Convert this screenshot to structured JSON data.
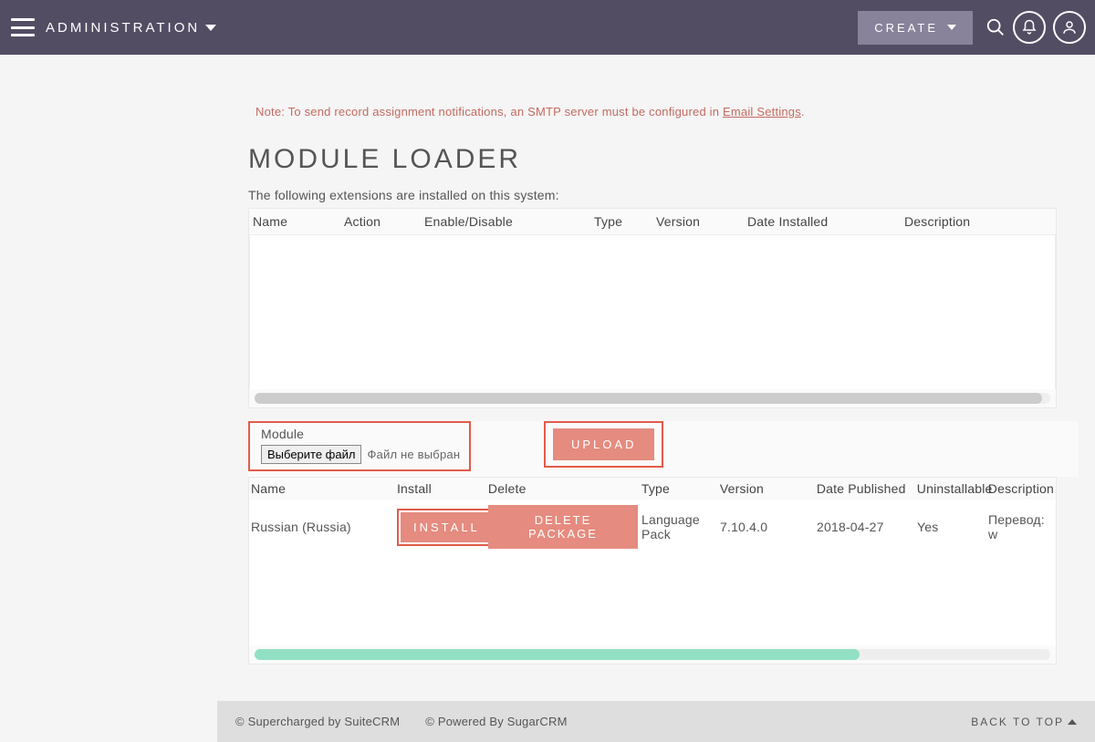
{
  "header": {
    "crumb": "ADMINISTRATION",
    "create": "CREATE"
  },
  "note": {
    "prefix": "Note: To send record assignment notifications, an SMTP server must be configured in ",
    "link": "Email Settings",
    "suffix": "."
  },
  "title": "MODULE LOADER",
  "installed": {
    "desc": "The following extensions are installed on this system:",
    "cols": [
      "Name",
      "Action",
      "Enable/Disable",
      "Type",
      "Version",
      "Date Installed",
      "Description"
    ]
  },
  "upload": {
    "module_label": "Module",
    "choose_file": "Выберите файл",
    "no_file": "Файл не выбран",
    "upload_btn": "UPLOAD"
  },
  "packages": {
    "cols": [
      "Name",
      "Install",
      "Delete",
      "Type",
      "Version",
      "Date Published",
      "Uninstallable",
      "Description"
    ],
    "rows": [
      {
        "name": "Russian (Russia)",
        "install_btn": "INSTALL",
        "delete_btn": "DELETE PACKAGE",
        "type": "Language Pack",
        "version": "7.10.4.0",
        "date": "2018-04-27",
        "uninstallable": "Yes",
        "description": "Перевод: w"
      }
    ]
  },
  "footer": {
    "s1": "© Supercharged by SuiteCRM",
    "s2": "© Powered By SugarCRM",
    "back": "BACK TO TOP"
  }
}
